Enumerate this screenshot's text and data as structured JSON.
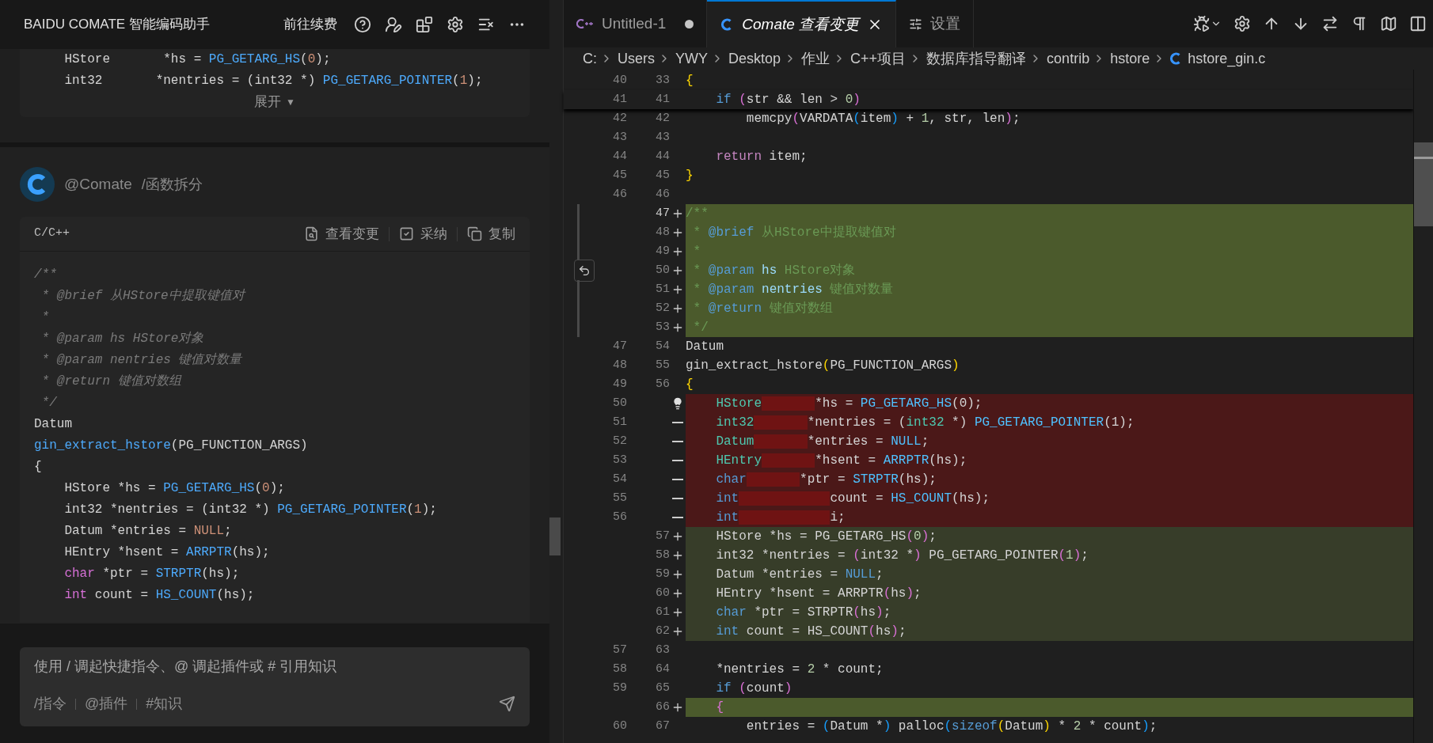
{
  "assistant": {
    "title": "BAIDU COMATE 智能编码助手",
    "renew_link": "前往续费",
    "snippet": {
      "lines": [
        [
          {
            "text": "    HStore       *hs = ",
            "kind": "p"
          },
          {
            "text": "PG_GETARG_HS",
            "kind": "fn"
          },
          {
            "text": "(",
            "kind": "p"
          },
          {
            "text": "0",
            "kind": "num"
          },
          {
            "text": ");",
            "kind": "p"
          }
        ],
        [
          {
            "text": "    int32       *nentries = (int32 *) ",
            "kind": "p"
          },
          {
            "text": "PG_GETARG_POINTER",
            "kind": "fn"
          },
          {
            "text": "(",
            "kind": "p"
          },
          {
            "text": "1",
            "kind": "num"
          },
          {
            "text": ");",
            "kind": "p"
          }
        ]
      ],
      "expand_label": "展开",
      "expand_icon": "▼"
    },
    "message": {
      "author": "@Comate",
      "command": "/函数拆分",
      "code_block": {
        "language": "C/C++",
        "actions": [
          {
            "label": "查看变更",
            "kind": "diff"
          },
          {
            "label": "采纳",
            "kind": "accept"
          },
          {
            "label": "复制",
            "kind": "copy"
          }
        ],
        "lines": [
          [
            {
              "text": "/**",
              "kind": "cm"
            }
          ],
          [
            {
              "text": " * @brief 从HStore中提取键值对",
              "kind": "cm"
            }
          ],
          [
            {
              "text": " *",
              "kind": "cm"
            }
          ],
          [
            {
              "text": " * @param hs HStore对象",
              "kind": "cm"
            }
          ],
          [
            {
              "text": " * @param nentries 键值对数量",
              "kind": "cm"
            }
          ],
          [
            {
              "text": " * @return 键值对数组",
              "kind": "cm"
            }
          ],
          [
            {
              "text": " */",
              "kind": "cm"
            }
          ],
          [
            {
              "text": "Datum",
              "kind": "p"
            }
          ],
          [
            {
              "text": "gin_extract_hstore",
              "kind": "fn"
            },
            {
              "text": "(PG_FUNCTION_ARGS)",
              "kind": "p"
            }
          ],
          [
            {
              "text": "{",
              "kind": "p"
            }
          ],
          [
            {
              "text": "    HStore *hs = ",
              "kind": "p"
            },
            {
              "text": "PG_GETARG_HS",
              "kind": "fn"
            },
            {
              "text": "(",
              "kind": "p"
            },
            {
              "text": "0",
              "kind": "num"
            },
            {
              "text": ");",
              "kind": "p"
            }
          ],
          [
            {
              "text": "    int32 *nentries = (int32 *) ",
              "kind": "p"
            },
            {
              "text": "PG_GETARG_POINTER",
              "kind": "fn"
            },
            {
              "text": "(",
              "kind": "p"
            },
            {
              "text": "1",
              "kind": "num"
            },
            {
              "text": ");",
              "kind": "p"
            }
          ],
          [
            {
              "text": "    Datum *entries = ",
              "kind": "p"
            },
            {
              "text": "NULL",
              "kind": "num"
            },
            {
              "text": ";",
              "kind": "p"
            }
          ],
          [
            {
              "text": "    HEntry *hsent = ",
              "kind": "p"
            },
            {
              "text": "ARRPTR",
              "kind": "fn"
            },
            {
              "text": "(hs);",
              "kind": "p"
            }
          ],
          [
            {
              "text": "    char",
              "kind": "kw"
            },
            {
              "text": " *ptr = ",
              "kind": "p"
            },
            {
              "text": "STRPTR",
              "kind": "fn"
            },
            {
              "text": "(hs);",
              "kind": "p"
            }
          ],
          [
            {
              "text": "    int",
              "kind": "kw"
            },
            {
              "text": " count = ",
              "kind": "p"
            },
            {
              "text": "HS_COUNT",
              "kind": "fn"
            },
            {
              "text": "(hs);",
              "kind": "p"
            }
          ]
        ]
      }
    },
    "input": {
      "placeholder": "使用 / 调起快捷指令、@ 调起插件或 # 引用知识",
      "shortcuts": [
        "/指令",
        "@插件",
        "#知识"
      ]
    }
  },
  "editor": {
    "tabs": [
      {
        "label": "Untitled-1",
        "kind": "cpp",
        "selected": false,
        "dirty": true
      },
      {
        "label": "Comate 查看变更",
        "kind": "c",
        "selected": true,
        "dirty": false
      },
      {
        "label": "设置",
        "kind": "settings",
        "selected": false,
        "dirty": false
      }
    ],
    "breadcrumb": [
      {
        "label": "C:"
      },
      {
        "label": "Users"
      },
      {
        "label": "YWY"
      },
      {
        "label": "Desktop"
      },
      {
        "label": "作业"
      },
      {
        "label": "C++项目"
      },
      {
        "label": "数据库指导翻译"
      },
      {
        "label": "contrib"
      },
      {
        "label": "hstore"
      },
      {
        "label": "hstore_gin.c",
        "kind": "c"
      }
    ],
    "rows": [
      {
        "old": "40",
        "new": "33",
        "kind": "context",
        "tokens": [
          {
            "text": "{",
            "kind": "b1"
          }
        ]
      },
      {
        "old": "41",
        "new": "41",
        "kind": "context",
        "tokens": [
          {
            "text": "    if ",
            "kind": "kw"
          },
          {
            "text": "(",
            "kind": "b2"
          },
          {
            "text": "str && len > ",
            "kind": "p"
          },
          {
            "text": "0",
            "kind": "num"
          },
          {
            "text": ")",
            "kind": "b2"
          }
        ]
      },
      {
        "old": "42",
        "new": "42",
        "kind": "context",
        "tokens": [
          {
            "text": "        memcpy",
            "kind": "p"
          },
          {
            "text": "(",
            "kind": "b2"
          },
          {
            "text": "VARDATA",
            "kind": "p"
          },
          {
            "text": "(",
            "kind": "b3"
          },
          {
            "text": "item",
            "kind": "p"
          },
          {
            "text": ")",
            "kind": "b3"
          },
          {
            "text": " + ",
            "kind": "p"
          },
          {
            "text": "1",
            "kind": "num"
          },
          {
            "text": ", str, len",
            "kind": "p"
          },
          {
            "text": ")",
            "kind": "b2"
          },
          {
            "text": ";",
            "kind": "p"
          }
        ]
      },
      {
        "old": "43",
        "new": "43",
        "kind": "context"
      },
      {
        "old": "44",
        "new": "44",
        "kind": "context",
        "tokens": [
          {
            "text": "    return",
            "kind": "ctl"
          },
          {
            "text": " item;",
            "kind": "p"
          }
        ]
      },
      {
        "old": "45",
        "new": "45",
        "kind": "context",
        "tokens": [
          {
            "text": "}",
            "kind": "b1"
          }
        ]
      },
      {
        "old": "46",
        "new": "46",
        "kind": "context"
      },
      {
        "new": "47",
        "kind": "added",
        "tokens": [
          {
            "text": "/**",
            "kind": "cm"
          }
        ]
      },
      {
        "new": "48",
        "kind": "added",
        "tokens": [
          {
            "text": " * ",
            "kind": "cm"
          },
          {
            "text": "@brief",
            "kind": "doc"
          },
          {
            "text": " 从HStore中提取键值对",
            "kind": "cm"
          }
        ]
      },
      {
        "new": "49",
        "kind": "added",
        "tokens": [
          {
            "text": " *",
            "kind": "cm"
          }
        ]
      },
      {
        "new": "50",
        "kind": "added",
        "revert": true,
        "tokens": [
          {
            "text": " * ",
            "kind": "cm"
          },
          {
            "text": "@param",
            "kind": "doc"
          },
          {
            "text": " hs",
            "kind": "par"
          },
          {
            "text": " HStore对象",
            "kind": "cm"
          }
        ]
      },
      {
        "new": "51",
        "kind": "added",
        "tokens": [
          {
            "text": " * ",
            "kind": "cm"
          },
          {
            "text": "@param",
            "kind": "doc"
          },
          {
            "text": " nentries",
            "kind": "par"
          },
          {
            "text": " 键值对数量",
            "kind": "cm"
          }
        ]
      },
      {
        "new": "52",
        "kind": "added",
        "tokens": [
          {
            "text": " * ",
            "kind": "cm"
          },
          {
            "text": "@return",
            "kind": "doc"
          },
          {
            "text": " 键值对数组",
            "kind": "cm"
          }
        ]
      },
      {
        "new": "53",
        "kind": "added",
        "tokens": [
          {
            "text": " */",
            "kind": "cm"
          }
        ]
      },
      {
        "old": "47",
        "new": "54",
        "kind": "context",
        "tokens": [
          {
            "text": "Datum",
            "kind": "p"
          }
        ]
      },
      {
        "old": "48",
        "new": "55",
        "kind": "context",
        "tokens": [
          {
            "text": "gin_extract_hstore",
            "kind": "p"
          },
          {
            "text": "(",
            "kind": "b1"
          },
          {
            "text": "PG_FUNCTION_ARGS",
            "kind": "p"
          },
          {
            "text": ")",
            "kind": "b1"
          }
        ]
      },
      {
        "old": "49",
        "new": "56",
        "kind": "context",
        "tokens": [
          {
            "text": "{",
            "kind": "b1"
          }
        ]
      },
      {
        "old": "50",
        "kind": "removed",
        "lightbulb": true,
        "tokens": [
          {
            "text": "    HStore       ",
            "kind": "ty",
            "gap_removed": true
          },
          {
            "text": "*hs = ",
            "kind": "p"
          },
          {
            "text": "PG_GETARG_HS",
            "kind": "mac"
          },
          {
            "text": "(0);",
            "kind": "p"
          }
        ]
      },
      {
        "old": "51",
        "kind": "removed",
        "tokens": [
          {
            "text": "    int32       ",
            "kind": "ty",
            "gap_removed": true
          },
          {
            "text": "*nentries = (",
            "kind": "p"
          },
          {
            "text": "int32",
            "kind": "ty"
          },
          {
            "text": " *) ",
            "kind": "p"
          },
          {
            "text": "PG_GETARG_POINTER",
            "kind": "mac"
          },
          {
            "text": "(1);",
            "kind": "p"
          }
        ]
      },
      {
        "old": "52",
        "kind": "removed",
        "tokens": [
          {
            "text": "    Datum       ",
            "kind": "ty",
            "gap_removed": true
          },
          {
            "text": "*entries = ",
            "kind": "p"
          },
          {
            "text": "NULL",
            "kind": "mac"
          },
          {
            "text": ";",
            "kind": "p"
          }
        ]
      },
      {
        "old": "53",
        "kind": "removed",
        "tokens": [
          {
            "text": "    HEntry       ",
            "kind": "ty",
            "gap_removed": true
          },
          {
            "text": "*hsent = ",
            "kind": "p"
          },
          {
            "text": "ARRPTR",
            "kind": "mac"
          },
          {
            "text": "(hs);",
            "kind": "p"
          }
        ]
      },
      {
        "old": "54",
        "kind": "removed",
        "tokens": [
          {
            "text": "    char       ",
            "kind": "kw",
            "gap_removed": true
          },
          {
            "text": "*ptr = ",
            "kind": "p"
          },
          {
            "text": "STRPTR",
            "kind": "mac"
          },
          {
            "text": "(hs);",
            "kind": "p"
          }
        ]
      },
      {
        "old": "55",
        "kind": "removed",
        "tokens": [
          {
            "text": "    int            ",
            "kind": "kw",
            "gap_removed": true
          },
          {
            "text": "count = ",
            "kind": "p"
          },
          {
            "text": "HS_COUNT",
            "kind": "mac"
          },
          {
            "text": "(hs);",
            "kind": "p"
          }
        ]
      },
      {
        "old": "56",
        "kind": "removed",
        "tokens": [
          {
            "text": "    int            ",
            "kind": "kw",
            "gap_removed": true
          },
          {
            "text": "i;",
            "kind": "p"
          }
        ]
      },
      {
        "new": "57",
        "kind": "modified",
        "tokens": [
          {
            "text": "    HStore *hs = PG_GETARG_HS",
            "kind": "p"
          },
          {
            "text": "(",
            "kind": "b2"
          },
          {
            "text": "0",
            "kind": "num"
          },
          {
            "text": ")",
            "kind": "b2"
          },
          {
            "text": ";",
            "kind": "p"
          }
        ]
      },
      {
        "new": "58",
        "kind": "modified",
        "tokens": [
          {
            "text": "    int32 *nentries = ",
            "kind": "p"
          },
          {
            "text": "(",
            "kind": "b2"
          },
          {
            "text": "int32 *",
            "kind": "p"
          },
          {
            "text": ")",
            "kind": "b2"
          },
          {
            "text": " PG_GETARG_POINTER",
            "kind": "p"
          },
          {
            "text": "(",
            "kind": "b2"
          },
          {
            "text": "1",
            "kind": "num"
          },
          {
            "text": ")",
            "kind": "b2"
          },
          {
            "text": ";",
            "kind": "p"
          }
        ]
      },
      {
        "new": "59",
        "kind": "modified",
        "tokens": [
          {
            "text": "    Datum *entries = ",
            "kind": "p"
          },
          {
            "text": "NULL",
            "kind": "kw"
          },
          {
            "text": ";",
            "kind": "p"
          }
        ]
      },
      {
        "new": "60",
        "kind": "modified",
        "tokens": [
          {
            "text": "    HEntry *hsent = ARRPTR",
            "kind": "p"
          },
          {
            "text": "(",
            "kind": "b2"
          },
          {
            "text": "hs",
            "kind": "p"
          },
          {
            "text": ")",
            "kind": "b2"
          },
          {
            "text": ";",
            "kind": "p"
          }
        ]
      },
      {
        "new": "61",
        "kind": "modified",
        "tokens": [
          {
            "text": "    char",
            "kind": "kw"
          },
          {
            "text": " *ptr = STRPTR",
            "kind": "p"
          },
          {
            "text": "(",
            "kind": "b2"
          },
          {
            "text": "hs",
            "kind": "p"
          },
          {
            "text": ")",
            "kind": "b2"
          },
          {
            "text": ";",
            "kind": "p"
          }
        ]
      },
      {
        "new": "62",
        "kind": "modified",
        "tokens": [
          {
            "text": "    int",
            "kind": "kw"
          },
          {
            "text": " count = HS_COUNT",
            "kind": "p"
          },
          {
            "text": "(",
            "kind": "b2"
          },
          {
            "text": "hs",
            "kind": "p"
          },
          {
            "text": ")",
            "kind": "b2"
          },
          {
            "text": ";",
            "kind": "p"
          }
        ]
      },
      {
        "old": "57",
        "new": "63",
        "kind": "context"
      },
      {
        "old": "58",
        "new": "64",
        "kind": "context",
        "tokens": [
          {
            "text": "    *nentries = ",
            "kind": "p"
          },
          {
            "text": "2",
            "kind": "num"
          },
          {
            "text": " * count;",
            "kind": "p"
          }
        ]
      },
      {
        "old": "59",
        "new": "65",
        "kind": "context",
        "tokens": [
          {
            "text": "    if ",
            "kind": "kw"
          },
          {
            "text": "(",
            "kind": "b2"
          },
          {
            "text": "count",
            "kind": "p"
          },
          {
            "text": ")",
            "kind": "b2"
          }
        ]
      },
      {
        "new": "66",
        "kind": "added",
        "tokens": [
          {
            "text": "    {",
            "kind": "b2"
          }
        ]
      },
      {
        "old": "60",
        "new": "67",
        "kind": "context",
        "tokens": [
          {
            "text": "        entries = ",
            "kind": "p"
          },
          {
            "text": "(",
            "kind": "b3"
          },
          {
            "text": "Datum *",
            "kind": "p"
          },
          {
            "text": ")",
            "kind": "b3"
          },
          {
            "text": " palloc",
            "kind": "p"
          },
          {
            "text": "(",
            "kind": "b3"
          },
          {
            "text": "sizeof",
            "kind": "kw"
          },
          {
            "text": "(",
            "kind": "b1"
          },
          {
            "text": "Datum",
            "kind": "p"
          },
          {
            "text": ")",
            "kind": "b1"
          },
          {
            "text": " * ",
            "kind": "p"
          },
          {
            "text": "2",
            "kind": "num"
          },
          {
            "text": " * count",
            "kind": "p"
          },
          {
            "text": ")",
            "kind": "b3"
          },
          {
            "text": ";",
            "kind": "p"
          }
        ]
      }
    ]
  }
}
